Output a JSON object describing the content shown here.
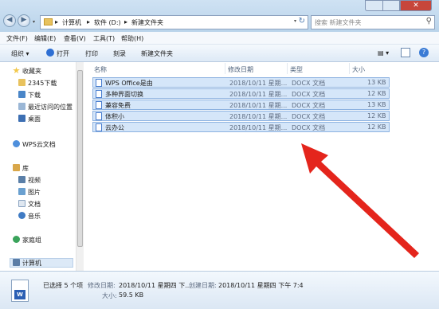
{
  "window": {
    "close_glyph": "✕"
  },
  "nav": {
    "back_glyph": "◀",
    "forward_glyph": "▶",
    "recent_glyph": "▾"
  },
  "address": {
    "segments": [
      "计算机",
      "软件 (D:)",
      "新建文件夹"
    ],
    "separator": "▸",
    "dropdown_glyph": "▾",
    "refresh_glyph": "↻"
  },
  "search": {
    "placeholder": "搜索 新建文件夹",
    "icon_glyph": "⚲"
  },
  "menu": [
    "文件(F)",
    "编辑(E)",
    "查看(V)",
    "工具(T)",
    "帮助(H)"
  ],
  "toolbar": {
    "organize": "组织 ▾",
    "open": "打开",
    "print": "打印",
    "burn": "刻录",
    "new_folder": "新建文件夹",
    "view_glyph": "▤ ▾"
  },
  "sidebar": {
    "favorites_header": "收藏夹",
    "favorites": [
      "2345下载",
      "下载",
      "最近访问的位置",
      "桌面"
    ],
    "wps_cloud": "WPS云文档",
    "library_header": "库",
    "libraries": [
      "视频",
      "图片",
      "文档",
      "音乐"
    ],
    "homegroup": "家庭组",
    "computer": "计算机"
  },
  "columns": {
    "name": "名称",
    "modified": "修改日期",
    "type": "类型",
    "size": "大小"
  },
  "files": [
    {
      "name": "WPS Office是由",
      "modified": "2018/10/11 星期...",
      "type": "DOCX 文档",
      "size": "13 KB"
    },
    {
      "name": "多种界面切换",
      "modified": "2018/10/11 星期...",
      "type": "DOCX 文档",
      "size": "12 KB"
    },
    {
      "name": "兼容免费",
      "modified": "2018/10/11 星期...",
      "type": "DOCX 文档",
      "size": "13 KB"
    },
    {
      "name": "体积小",
      "modified": "2018/10/11 星期...",
      "type": "DOCX 文档",
      "size": "12 KB"
    },
    {
      "name": "云办公",
      "modified": "2018/10/11 星期...",
      "type": "DOCX 文档",
      "size": "12 KB"
    }
  ],
  "details": {
    "selected": "已选择 5 个项",
    "modified_label": "修改日期:",
    "modified_value": "2018/10/11 星期四 下...",
    "created_label": "创建日期:",
    "created_value": "2018/10/11 星期四 下午 7:4",
    "created_value2": "2018/10/11 星期四 下午 7:4",
    "size_label": "大小:",
    "size_value": "59.5 KB",
    "doc_glyph": "W"
  },
  "colors": {
    "arrow": "#e4251c",
    "selection": "#d5e6f9",
    "selection_border": "#8db2e0"
  }
}
